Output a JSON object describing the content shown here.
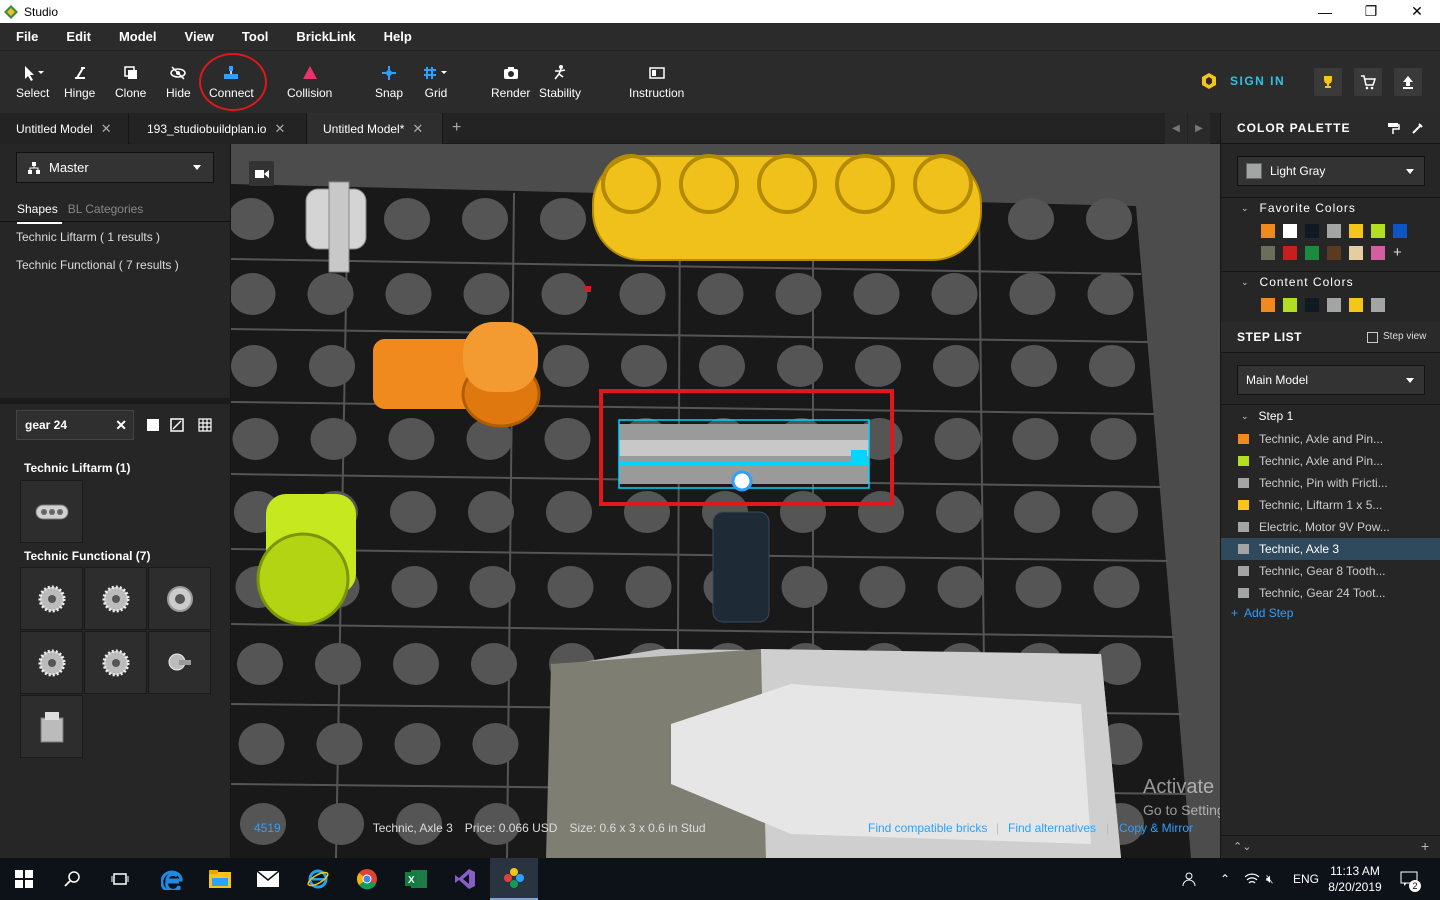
{
  "window": {
    "title": "Studio",
    "minimize": "—",
    "restore": "❐",
    "close": "✕"
  },
  "menu": [
    "File",
    "Edit",
    "Model",
    "View",
    "Tool",
    "BrickLink",
    "Help"
  ],
  "toolbar": {
    "tools": [
      {
        "label": "Select",
        "icon": "cursor-icon"
      },
      {
        "label": "Hinge",
        "icon": "hinge-icon"
      },
      {
        "label": "Clone",
        "icon": "clone-icon"
      },
      {
        "label": "Hide",
        "icon": "hide-icon"
      },
      {
        "label": "Connect",
        "icon": "connect-icon"
      },
      {
        "label": "Collision",
        "icon": "collision-icon"
      },
      {
        "label": "Snap",
        "icon": "snap-icon"
      },
      {
        "label": "Grid",
        "icon": "grid-icon"
      },
      {
        "label": "Render",
        "icon": "camera-icon"
      },
      {
        "label": "Stability",
        "icon": "stability-icon"
      },
      {
        "label": "Instruction",
        "icon": "instruction-icon"
      }
    ],
    "sign_in": "SIGN IN"
  },
  "tabs": [
    {
      "label": "Untitled Model",
      "close": "✕"
    },
    {
      "label": "193_studiobuildplan.io",
      "close": "✕"
    },
    {
      "label": "Untitled Model*",
      "close": "✕"
    }
  ],
  "tab_add": "+",
  "left": {
    "palette_select": "Master",
    "shape_tabs": [
      "Shapes",
      "BL Categories"
    ],
    "categories": [
      "Technic Liftarm ( 1 results )",
      "Technic Functional ( 7 results )"
    ],
    "search": {
      "value": "gear 24",
      "clear": "✕"
    },
    "result_groups": [
      {
        "title": "Technic Liftarm (1)",
        "count": 1
      },
      {
        "title": "Technic Functional (7)",
        "count": 7
      }
    ]
  },
  "status": {
    "id": "4519",
    "name": "Technic, Axle 3",
    "price": "Price: 0.066 USD",
    "size": "Size: 0.6 x 3 x 0.6 in Stud",
    "links": [
      "Find compatible bricks",
      "Find alternatives",
      "Copy & Mirror"
    ],
    "sep": "|"
  },
  "watermark": {
    "line1": "Activate Windows",
    "line2": "Go to Settings to activate Windows."
  },
  "right": {
    "color_palette_title": "COLOR PALETTE",
    "color_select": "Light Gray",
    "favorite_colors_title": "Favorite Colors",
    "favorite_colors": [
      "#f08a1e",
      "#ffffff",
      "#0e1a24",
      "#a2a5a3",
      "#f5c518",
      "#b2e020",
      "#0b55c4",
      "#6b6e5c",
      "#c81e1e",
      "#1a8a3c",
      "#5a3a20",
      "#e4cd9e",
      "#d35ea0"
    ],
    "add_color": "+",
    "content_colors_title": "Content Colors",
    "content_colors": [
      "#f08a1e",
      "#b2e020",
      "#0e1a24",
      "#a2a5a3",
      "#f5c518",
      "#a2a5a3"
    ],
    "step_list_title": "STEP LIST",
    "step_view": "Step view",
    "model_select": "Main Model",
    "step_label": "Step 1",
    "steps": [
      {
        "label": "Technic, Axle and Pin...",
        "color": "#f08a1e"
      },
      {
        "label": "Technic, Axle and Pin...",
        "color": "#b2e020"
      },
      {
        "label": "Technic, Pin with Fricti...",
        "color": "#a2a5a3"
      },
      {
        "label": "Technic, Liftarm 1 x 5...",
        "color": "#f5c518"
      },
      {
        "label": "Electric, Motor 9V Pow...",
        "color": "#a2a5a3"
      },
      {
        "label": "Technic, Axle 3",
        "color": "#a2a5a3"
      },
      {
        "label": "Technic, Gear 8 Tooth...",
        "color": "#a2a5a3"
      },
      {
        "label": "Technic, Gear 24 Toot...",
        "color": "#a2a5a3"
      }
    ],
    "selected_step_index": 5,
    "add_step": "Add Step"
  },
  "taskbar": {
    "apps": [
      "start-icon",
      "search-icon",
      "task-view-icon",
      "edge-icon",
      "file-explorer-icon",
      "mail-icon",
      "internet-explorer-icon",
      "chrome-icon",
      "excel-icon",
      "visual-studio-icon",
      "studio-icon"
    ],
    "lang": "ENG",
    "time": "11:13 AM",
    "date": "8/20/2019",
    "notifications": "2"
  }
}
